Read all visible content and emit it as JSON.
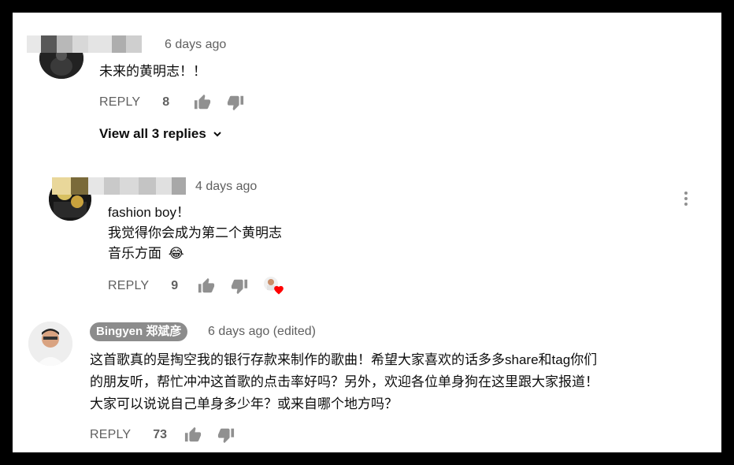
{
  "comments": [
    {
      "time": "6 days ago",
      "text_lines": [
        "未来的黄明志！！"
      ],
      "reply_label": "REPLY",
      "likes": "8",
      "view_replies": "View all 3 replies"
    },
    {
      "time": "4 days ago",
      "text_lines": [
        "fashion boy！",
        "我觉得你会成为第二个黄明志",
        "音乐方面"
      ],
      "emoji": "😂",
      "reply_label": "REPLY",
      "likes": "9"
    },
    {
      "author": "Bingyen 郑斌彦",
      "time": "6 days ago (edited)",
      "text_lines": [
        "这首歌真的是掏空我的银行存款来制作的歌曲！希望大家喜欢的话多多share和tag你们",
        "的朋友听，帮忙冲冲这首歌的点击率好吗？另外，欢迎各位单身狗在这里跟大家报道！",
        "大家可以说说自己单身多少年？或来自哪个地方吗？"
      ],
      "reply_label": "REPLY",
      "likes": "73"
    }
  ],
  "icons": {
    "like": "thumbs-up-icon",
    "dislike": "thumbs-down-icon",
    "expand": "chevron-down-icon",
    "menu": "more-vertical-icon",
    "creator_heart": "heart-icon"
  },
  "colors": {
    "background": "#ffffff",
    "frame": "#000000",
    "muted_text": "#606060",
    "badge": "#8c8c8c",
    "heart": "#ff0000"
  }
}
